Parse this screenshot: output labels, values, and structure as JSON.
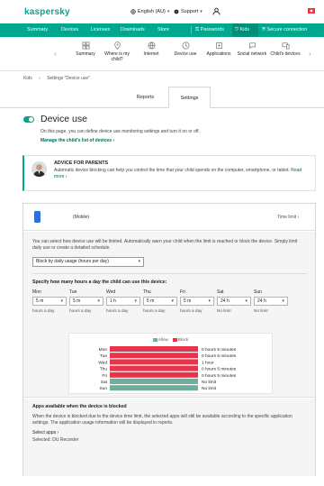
{
  "header": {
    "logo": "kaspersky",
    "language": "English (AU)",
    "support": "Support"
  },
  "main_nav": {
    "items": [
      "Summary",
      "Devices",
      "Licenses",
      "Downloads",
      "Store",
      "Passwords",
      "Kids",
      "Secure connection"
    ],
    "active": "Kids"
  },
  "sub_nav": {
    "items": [
      {
        "label": "Summary",
        "icon": "summary-icon"
      },
      {
        "label": "Where is my child?",
        "icon": "location-icon"
      },
      {
        "label": "Internet",
        "icon": "globe-icon"
      },
      {
        "label": "Device use",
        "icon": "device-use-icon"
      },
      {
        "label": "Applications",
        "icon": "applications-icon"
      },
      {
        "label": "Social network",
        "icon": "social-network-icon"
      },
      {
        "label": "Child's devices",
        "icon": "child-devices-icon"
      }
    ]
  },
  "breadcrumb": {
    "items": [
      "Kids",
      "›",
      "Settings \"Device use\""
    ]
  },
  "tabs": {
    "reports": "Reports",
    "settings": "Settings",
    "active": "Settings"
  },
  "section": {
    "title": "Device use",
    "description": "On this page, you can define device use monitoring settings and turn it on or off.",
    "manage_link": "Manage the child's list of devices ›"
  },
  "advice": {
    "title": "ADVICE FOR PARENTS",
    "text": "Automatic device blocking can help you control the time that your child spends on the computer, smartphone, or tablet.",
    "link": "Read more ›"
  },
  "device": {
    "name": "(Mobile)",
    "limit_label": "Time limit ›"
  },
  "limits": {
    "description": "You can select how device use will be limited. Automatically warn your child when the limit is reached or block the device. Simply limit daily use or create a detailed schedule.",
    "mode": "Block by daily usage (hours per day)",
    "specify_label": "Specify how many hours a day the child can use this device:",
    "days": [
      {
        "day": "Mon",
        "value": "5 m",
        "note": "hours a day"
      },
      {
        "day": "Tue",
        "value": "5 m",
        "note": "hours a day"
      },
      {
        "day": "Wed",
        "value": "1 h",
        "note": "hours a day"
      },
      {
        "day": "Thu",
        "value": "5 m",
        "note": "hours a day"
      },
      {
        "day": "Fri",
        "value": "5 m",
        "note": "hours a day"
      },
      {
        "day": "Sat",
        "value": "24 h",
        "note": "No limit"
      },
      {
        "day": "Sun",
        "value": "24 h",
        "note": "No limit"
      }
    ]
  },
  "chart_data": {
    "type": "bar",
    "legend": [
      "Allow",
      "Block"
    ],
    "colors": {
      "allow": "#6fae9c",
      "block": "#e8334a"
    },
    "categories": [
      "Mon",
      "Tue",
      "Wed",
      "Thu",
      "Fri",
      "Sat",
      "Sun"
    ],
    "series": [
      {
        "name": "Block",
        "values": [
          1,
          1,
          1,
          1,
          1,
          0,
          0
        ]
      },
      {
        "name": "Allow",
        "values": [
          0,
          0,
          0,
          0,
          0,
          1,
          1
        ]
      }
    ],
    "labels": [
      "0 hours 5 minutes",
      "0 hours 5 minutes",
      "1 hour",
      "0 hours 5 minutes",
      "0 hours 5 minutes",
      "No limit",
      "No limit"
    ]
  },
  "apps_section": {
    "title": "Apps available when the device is blocked",
    "text": "When the device is blocked due to the device time limit, the selected apps will still be available according to the specific application settings. The application usage information will be displayed in reports.",
    "select_link": "Select apps ›",
    "selected": "Selected: DU Recorder"
  },
  "colors": {
    "brand": "#00a88e",
    "brand_dark": "#008f78",
    "link": "#006d5b"
  }
}
